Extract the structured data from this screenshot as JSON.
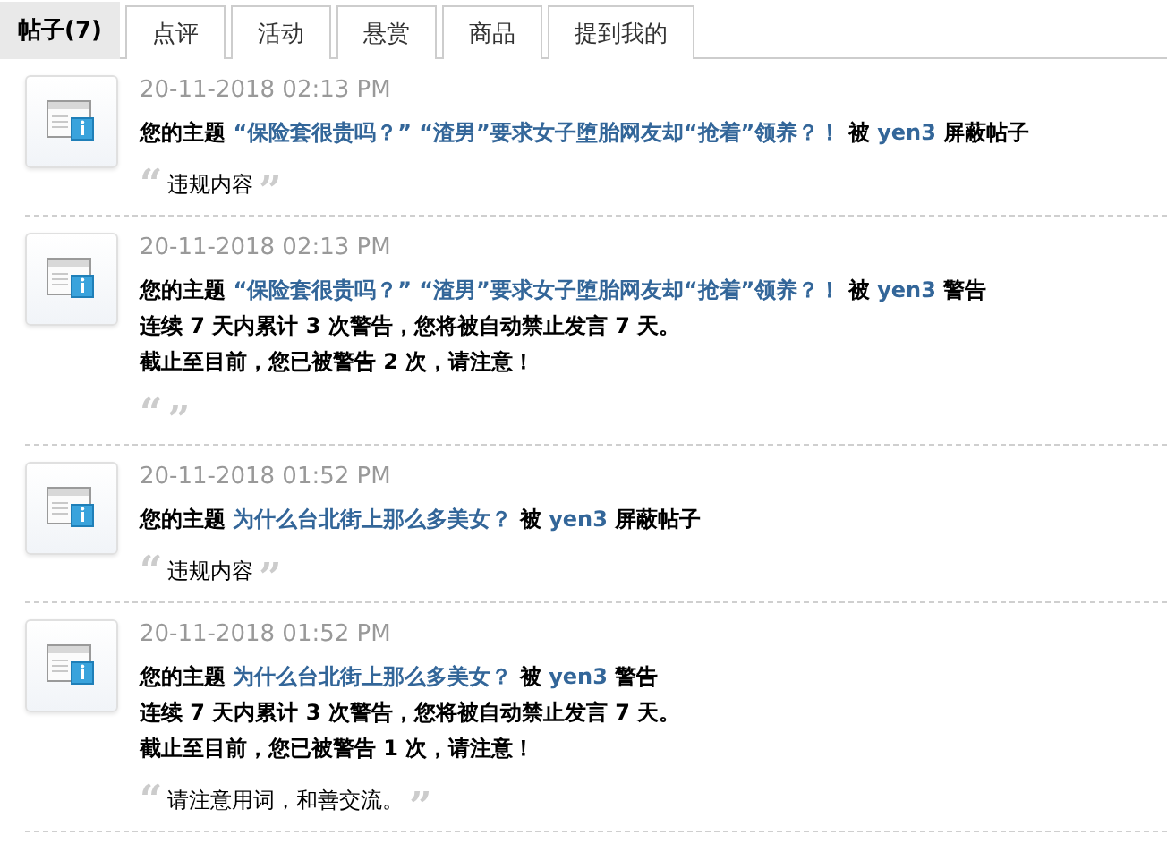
{
  "tabs": [
    {
      "label": "帖子(7)",
      "selected": true
    },
    {
      "label": "点评",
      "selected": false
    },
    {
      "label": "活动",
      "selected": false
    },
    {
      "label": "悬赏",
      "selected": false
    },
    {
      "label": "商品",
      "selected": false
    },
    {
      "label": "提到我的",
      "selected": false
    }
  ],
  "notices": [
    {
      "time": "20-11-2018 02:13 PM",
      "prefix": "您的主题",
      "topic": "“保险套很贵吗？” “渣男”要求女子堕胎网友却“抢着”领养？！",
      "by": "被",
      "user": "yen3",
      "action": "屏蔽帖子",
      "quote_open": "“",
      "quote": "违规内容",
      "quote_close": "”"
    },
    {
      "time": "20-11-2018 02:13 PM",
      "prefix": "您的主题",
      "topic": "“保险套很贵吗？” “渣男”要求女子堕胎网友却“抢着”领养？！",
      "by": "被",
      "user": "yen3",
      "action": "警告",
      "notes": [
        "连续 7 天内累计 3 次警告，您将被自动禁止发言 7 天。",
        "截止至目前，您已被警告 2 次，请注意！"
      ],
      "quote_open": "“",
      "quote_close": "”"
    },
    {
      "time": "20-11-2018 01:52 PM",
      "prefix": "您的主题",
      "topic": "为什么台北街上那么多美女？",
      "by": "被",
      "user": "yen3",
      "action": "屏蔽帖子",
      "quote_open": "“",
      "quote": "违规内容",
      "quote_close": "”"
    },
    {
      "time": "20-11-2018 01:52 PM",
      "prefix": "您的主题",
      "topic": "为什么台北街上那么多美女？",
      "by": "被",
      "user": "yen3",
      "action": "警告",
      "notes": [
        "连续 7 天内累计 3 次警告，您将被自动禁止发言 7 天。",
        "截止至目前，您已被警告 1 次，请注意！"
      ],
      "quote_open": "“",
      "quote": "请注意用词，和善交流。",
      "quote_close": "”"
    }
  ]
}
